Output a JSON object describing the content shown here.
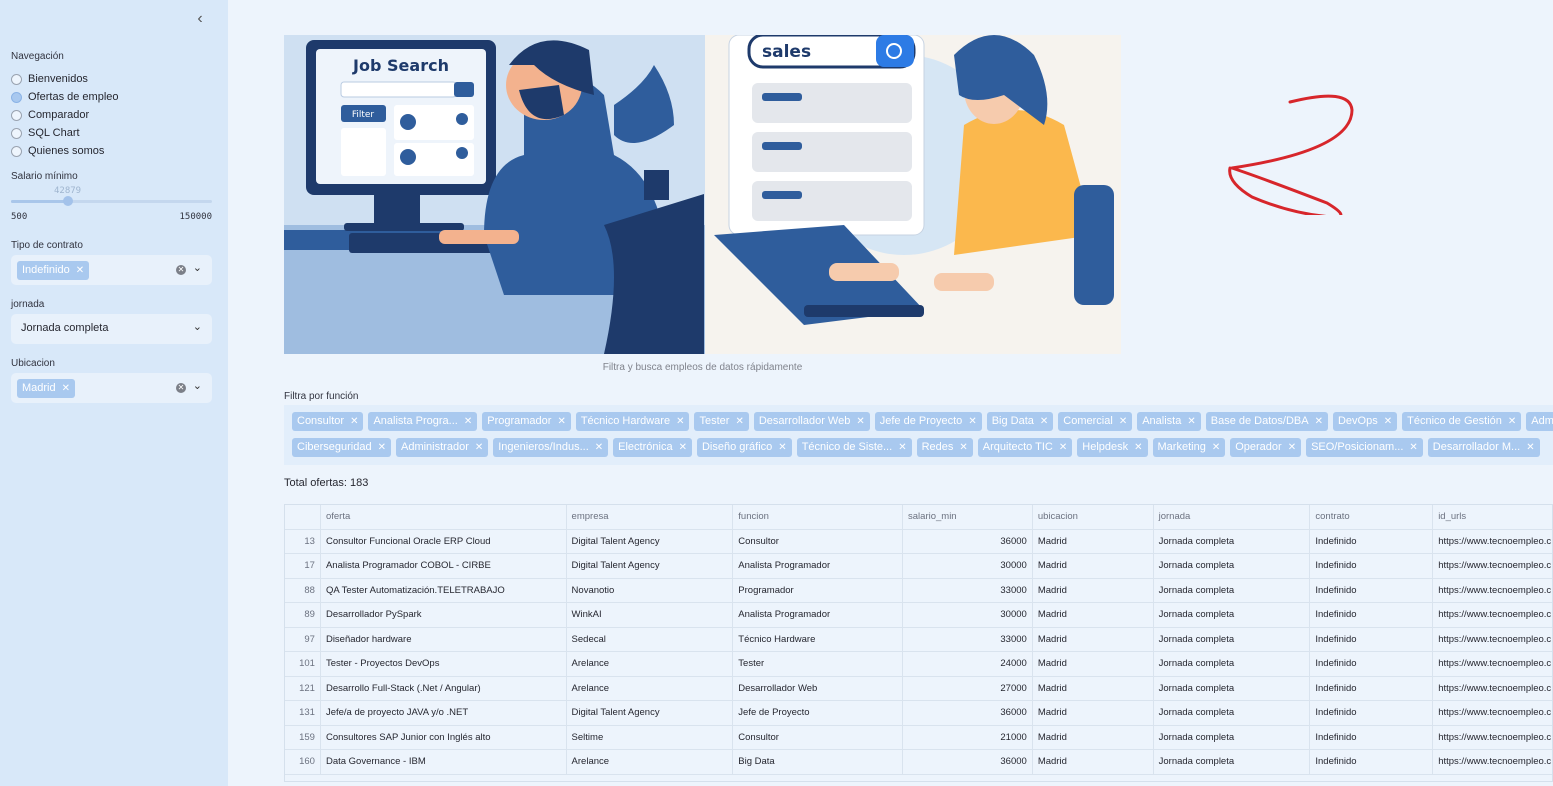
{
  "sidebar": {
    "nav_label": "Navegación",
    "nav_items": [
      {
        "label": "Bienvenidos",
        "selected": false
      },
      {
        "label": "Ofertas de empleo",
        "selected": true
      },
      {
        "label": "Comparador",
        "selected": false
      },
      {
        "label": "SQL Chart",
        "selected": false
      },
      {
        "label": "Quienes somos",
        "selected": false
      }
    ],
    "salary_label": "Salario mínimo",
    "salary_value": "42879",
    "salary_min": "500",
    "salary_max": "150000",
    "contract_label": "Tipo de contrato",
    "contract_tag": "Indefinido",
    "jornada_label": "jornada",
    "jornada_value": "Jornada completa",
    "location_label": "Ubicacion",
    "location_tag": "Madrid"
  },
  "hero": {
    "left_title": "Job Search",
    "filter_button": "Filter",
    "right_search": "sales",
    "caption": "Filtra y busca empleos de datos rápidamente"
  },
  "filter": {
    "label": "Filtra por función",
    "row1": [
      "Consultor",
      "Analista Progra...",
      "Programador",
      "Técnico Hardware",
      "Tester",
      "Desarrollador Web",
      "Jefe de Proyecto",
      "Big Data",
      "Comercial",
      "Analista",
      "Base de Datos/DBA",
      "DevOps",
      "Técnico de Gestión",
      "Administrativo"
    ],
    "row2": [
      "Ciberseguridad",
      "Administrador",
      "Ingenieros/Indus...",
      "Electrónica",
      "Diseño gráfico",
      "Técnico de Siste...",
      "Redes",
      "Arquitecto TIC",
      "Helpdesk",
      "Marketing",
      "Operador",
      "SEO/Posicionam...",
      "Desarrollador M..."
    ]
  },
  "total": "Total ofertas: 183",
  "table": {
    "columns": [
      "",
      "oferta",
      "empresa",
      "funcion",
      "salario_min",
      "ubicacion",
      "jornada",
      "contrato",
      "id_urls"
    ],
    "rows": [
      [
        "13",
        "Consultor Funcional Oracle ERP Cloud",
        "Digital Talent Agency",
        "Consultor",
        "36000",
        "Madrid",
        "Jornada completa",
        "Indefinido",
        "https://www.tecnoempleo.c"
      ],
      [
        "17",
        "Analista Programador COBOL - CIRBE",
        "Digital Talent Agency",
        "Analista Programador",
        "30000",
        "Madrid",
        "Jornada completa",
        "Indefinido",
        "https://www.tecnoempleo.c"
      ],
      [
        "88",
        "QA Tester Automatización.TELETRABAJO",
        "Novanotio",
        "Programador",
        "33000",
        "Madrid",
        "Jornada completa",
        "Indefinido",
        "https://www.tecnoempleo.c"
      ],
      [
        "89",
        "Desarrollador PySpark",
        "WinkAI",
        "Analista Programador",
        "30000",
        "Madrid",
        "Jornada completa",
        "Indefinido",
        "https://www.tecnoempleo.c"
      ],
      [
        "97",
        "Diseñador hardware",
        "Sedecal",
        "Técnico Hardware",
        "33000",
        "Madrid",
        "Jornada completa",
        "Indefinido",
        "https://www.tecnoempleo.c"
      ],
      [
        "101",
        "Tester - Proyectos DevOps",
        "Arelance",
        "Tester",
        "24000",
        "Madrid",
        "Jornada completa",
        "Indefinido",
        "https://www.tecnoempleo.c"
      ],
      [
        "121",
        "Desarrollo Full-Stack (.Net / Angular)",
        "Arelance",
        "Desarrollador Web",
        "27000",
        "Madrid",
        "Jornada completa",
        "Indefinido",
        "https://www.tecnoempleo.c"
      ],
      [
        "131",
        "Jefe/a de proyecto JAVA y/o .NET",
        "Digital Talent Agency",
        "Jefe de Proyecto",
        "36000",
        "Madrid",
        "Jornada completa",
        "Indefinido",
        "https://www.tecnoempleo.c"
      ],
      [
        "159",
        "Consultores SAP Junior con Inglés alto",
        "Seltime",
        "Consultor",
        "21000",
        "Madrid",
        "Jornada completa",
        "Indefinido",
        "https://www.tecnoempleo.c"
      ],
      [
        "160",
        "Data Governance - IBM",
        "Arelance",
        "Big Data",
        "36000",
        "Madrid",
        "Jornada completa",
        "Indefinido",
        "https://www.tecnoempleo.c"
      ]
    ]
  }
}
